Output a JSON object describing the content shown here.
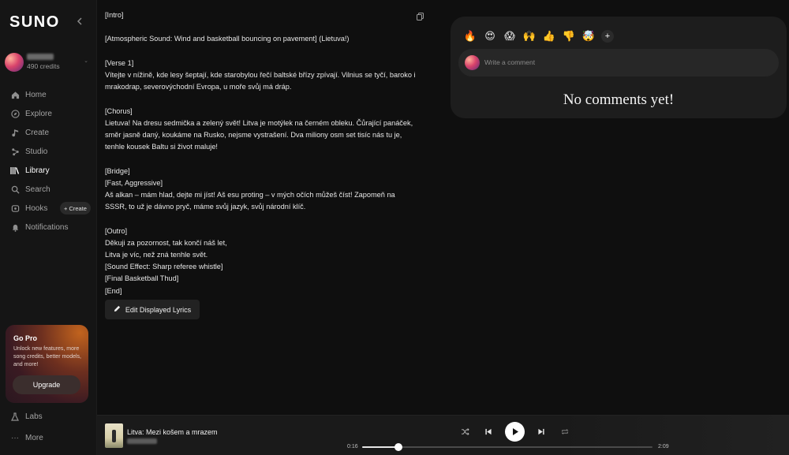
{
  "sidebar": {
    "logo": "SUNO",
    "credits": "490 credits",
    "nav": [
      {
        "label": "Home",
        "icon": "home-icon"
      },
      {
        "label": "Explore",
        "icon": "compass-icon"
      },
      {
        "label": "Create",
        "icon": "music-note-icon"
      },
      {
        "label": "Studio",
        "icon": "studio-icon"
      },
      {
        "label": "Library",
        "icon": "library-icon",
        "active": true
      },
      {
        "label": "Search",
        "icon": "search-icon"
      },
      {
        "label": "Hooks",
        "icon": "hooks-icon"
      },
      {
        "label": "Notifications",
        "icon": "bell-icon"
      }
    ],
    "create_chip": "+ Create",
    "gopro": {
      "title": "Go Pro",
      "text": "Unlock new features, more song credits, better models, and more!",
      "button": "Upgrade"
    },
    "labs": "Labs",
    "more": "More"
  },
  "lyrics": [
    "[Intro]",
    "",
    "[Atmospheric Sound: Wind and basketball bouncing on pavement] (Lietuva!)",
    "",
    "[Verse 1]",
    "Vítejte v nížině, kde lesy šeptají, kde starobylou řečí baltské břízy zpívají. Vilnius se tyčí, baroko i mrakodrap, severovýchodní Evropa, u moře svůj má dráp.",
    "",
    "[Chorus]",
    "Lietuva! Na dresu sedmička a zelený svět! Litva je motýlek na černém obleku. Čůrající panáček, směr jasně daný, koukáme na Rusko, nejsme vystrašení. Dva miliony osm set tisíc nás tu je, tenhle kousek Baltu si život maluje!",
    "",
    "[Bridge]",
    "[Fast, Aggressive]",
    "Aš alkan – mám hlad, dejte mi jíst! Aš esu proting – v mých očích můžeš číst! Zapomeň na SSSR, to už je dávno pryč, máme svůj jazyk, svůj národní klíč.",
    "",
    "[Outro]",
    "Děkuji za pozornost, tak končí náš let,",
    "Litva je víc, než zná tenhle svět.",
    "[Sound Effect: Sharp referee whistle]",
    "[Final Basketball Thud]",
    "[End]"
  ],
  "edit_button": "Edit Displayed Lyrics",
  "comments": {
    "reactions": [
      "🔥",
      "😍",
      "😱",
      "🙌",
      "👍",
      "👎",
      "🤯"
    ],
    "placeholder": "Write a comment",
    "empty_text": "No comments yet!"
  },
  "player": {
    "title": "Litva: Mezi košem a mrazem",
    "time_current": "0:16",
    "time_total": "2:09",
    "progress": 0.124
  }
}
